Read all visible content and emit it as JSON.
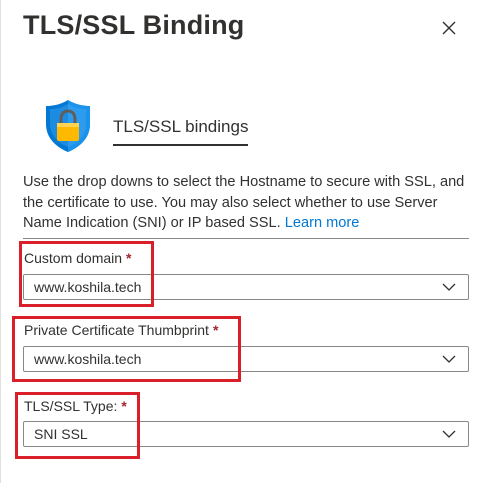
{
  "panel": {
    "title": "TLS/SSL Binding",
    "close_icon": "close-icon"
  },
  "section": {
    "icon": "shield-lock-icon",
    "heading": "TLS/SSL bindings",
    "description": "Use the drop downs to select the Hostname to secure with SSL, and the certificate to use. You may also select whether to use Server Name Indication (SNI) or IP based SSL.",
    "learn_more": "Learn more"
  },
  "fields": {
    "custom_domain": {
      "label": "Custom domain",
      "required_marker": "*",
      "value": "www.koshila.tech"
    },
    "certificate_thumbprint": {
      "label": "Private Certificate Thumbprint",
      "required_marker": "*",
      "value": "www.koshila.tech"
    },
    "tls_ssl_type": {
      "label": "TLS/SSL Type:",
      "required_marker": "*",
      "value": "SNI SSL"
    }
  },
  "colors": {
    "link": "#0078d4",
    "required": "#a4262c",
    "highlight": "#d9202a",
    "shield": "#0078d4",
    "lock": "#ffb900"
  }
}
